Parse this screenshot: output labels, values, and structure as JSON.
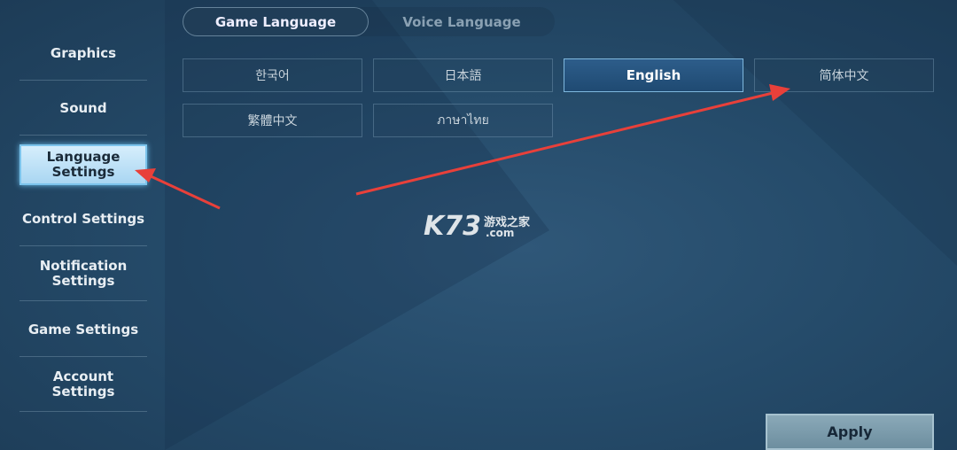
{
  "sidebar": {
    "items": [
      {
        "label": "Graphics"
      },
      {
        "label": "Sound"
      },
      {
        "label": "Language Settings",
        "active": true
      },
      {
        "label": "Control Settings"
      },
      {
        "label": "Notification Settings"
      },
      {
        "label": "Game Settings"
      },
      {
        "label": "Account Settings"
      }
    ]
  },
  "tabs": {
    "game_language": "Game Language",
    "voice_language": "Voice Language"
  },
  "languages": [
    "한국어",
    "日本語",
    "English",
    "简体中文",
    "繁體中文",
    "ภาษาไทย"
  ],
  "selected_language": "English",
  "apply_label": "Apply",
  "watermark": {
    "logo": "K73",
    "cn": "游戏之家",
    ".com": ".com"
  },
  "colors": {
    "annotation_arrow": "#e8403a",
    "selected_border": "#7fb8de"
  }
}
